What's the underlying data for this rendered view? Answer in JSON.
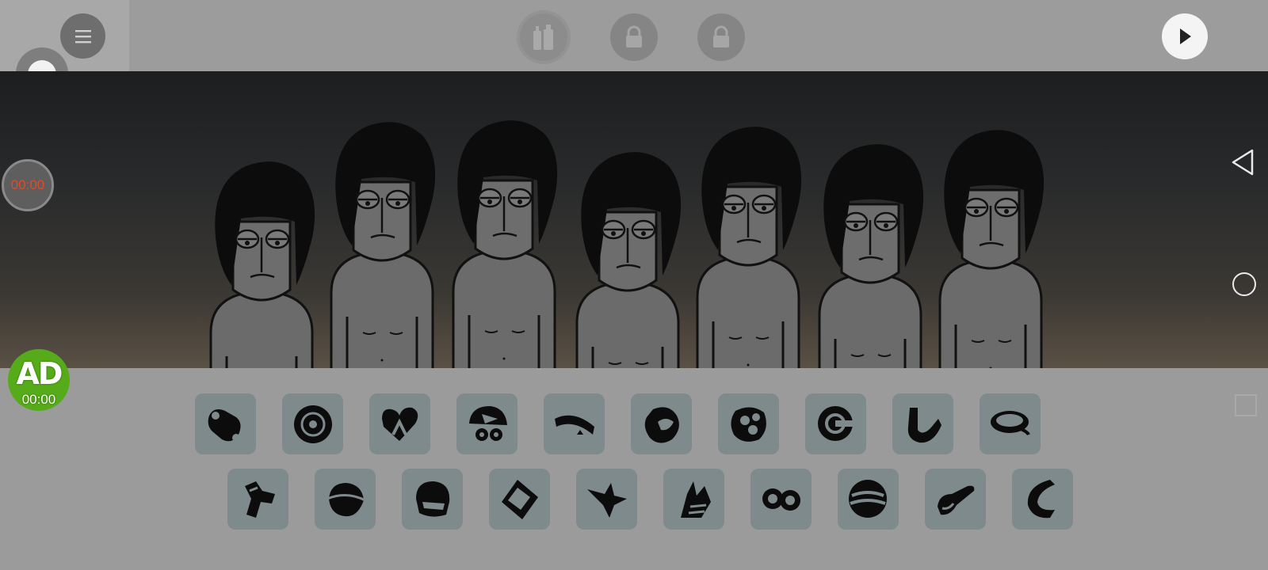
{
  "app": {
    "screen": "incredibox-stage"
  },
  "top_bar": {
    "menu_icon": "hamburger-icon",
    "record_icon": "record-dot-icon",
    "bonus_icons": [
      "bonus-bottles-icon",
      "lock-icon",
      "lock-icon"
    ],
    "play_icon": "play-icon"
  },
  "timer": {
    "text": "00:00",
    "color": "#e24a2a"
  },
  "ad_badge": {
    "label": "AD",
    "time": "00:00",
    "color": "#56ab1a"
  },
  "characters": {
    "count": 7,
    "state": "idle"
  },
  "sound_icons": {
    "row1": [
      "beat-icon",
      "disc-icon",
      "heart-arrow-icon",
      "cap-dots-icon",
      "headband-icon",
      "blob-icon",
      "film-reel-icon",
      "target-icon",
      "horseshoe-icon",
      "visor-icon"
    ],
    "row2": [
      "hammer-icon",
      "helmet-icon",
      "motorcycle-helmet-icon",
      "glasses-frame-icon",
      "mask-icon",
      "gloves-icon",
      "goggles-icon",
      "striped-ball-icon",
      "horn-icon",
      "crescent-icon"
    ]
  },
  "system_nav": {
    "back": "back-triangle-icon",
    "home": "home-circle-icon",
    "recents": "recents-square-icon"
  }
}
